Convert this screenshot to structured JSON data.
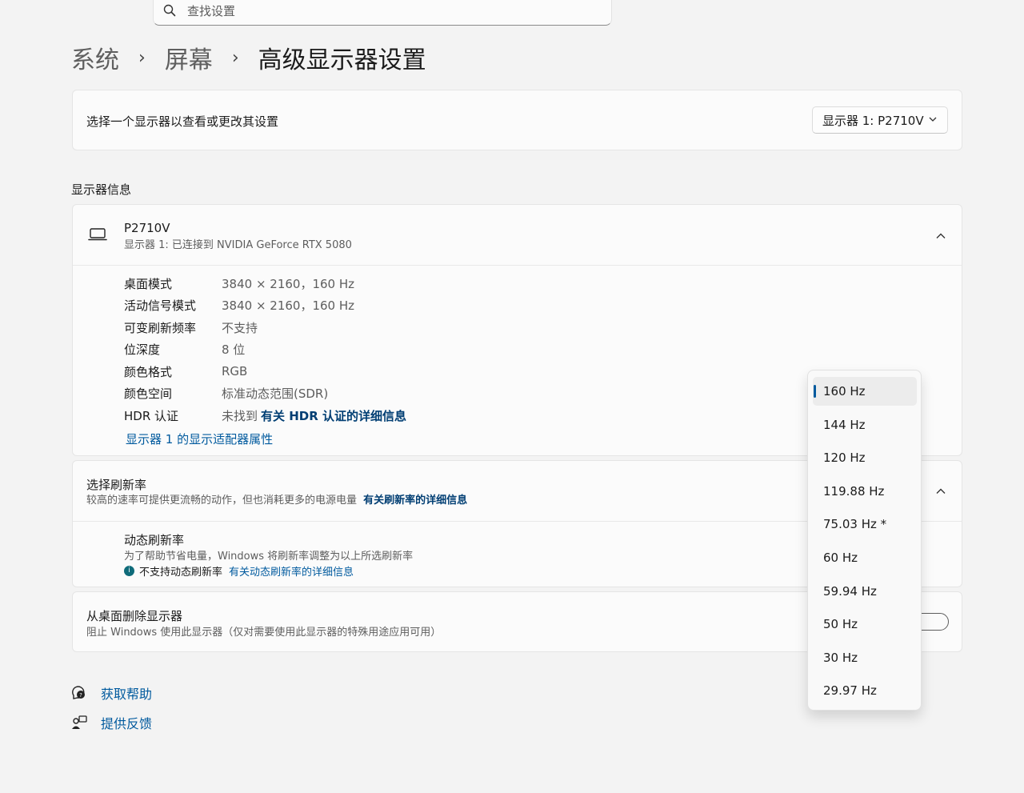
{
  "search": {
    "placeholder": "查找设置"
  },
  "breadcrumb": {
    "items": [
      "系统",
      "屏幕"
    ],
    "current": "高级显示器设置"
  },
  "select_monitor": {
    "label": "选择一个显示器以查看或更改其设置",
    "value": "显示器 1: P2710V"
  },
  "display_info": {
    "section_title": "显示器信息",
    "monitor_name": "P2710V",
    "monitor_desc": "显示器 1: 已连接到 NVIDIA GeForce RTX 5080",
    "rows": [
      {
        "label": "桌面模式",
        "value": "3840 × 2160，160 Hz"
      },
      {
        "label": "活动信号模式",
        "value": "3840 × 2160，160 Hz"
      },
      {
        "label": "可变刷新频率",
        "value": "不支持"
      },
      {
        "label": "位深度",
        "value": "8 位"
      },
      {
        "label": "颜色格式",
        "value": "RGB"
      },
      {
        "label": "颜色空间",
        "value": "标准动态范围(SDR)"
      },
      {
        "label": "HDR 认证",
        "value": "未找到",
        "link": "有关 HDR 认证的详细信息"
      }
    ],
    "adapter_link": "显示器 1 的显示适配器属性"
  },
  "refresh_rate": {
    "title": "选择刷新率",
    "desc": "较高的速率可提供更流畅的动作，但也消耗更多的电源电量",
    "link": "有关刷新率的详细信息",
    "options": [
      "160 Hz",
      "144 Hz",
      "120 Hz",
      "119.88 Hz",
      "75.03 Hz *",
      "60 Hz",
      "59.94 Hz",
      "50 Hz",
      "30 Hz",
      "29.97 Hz"
    ],
    "selected": "160 Hz"
  },
  "dynamic_refresh": {
    "title": "动态刷新率",
    "desc": "为了帮助节省电量，Windows 将刷新率调整为以上所选刷新率",
    "note": "不支持动态刷新率",
    "note_link": "有关动态刷新率的详细信息"
  },
  "remove_display": {
    "title": "从桌面删除显示器",
    "desc": "阻止 Windows 使用此显示器（仅对需要使用此显示器的特殊用途应用可用）",
    "toggle_on": false
  },
  "footer": {
    "help": "获取帮助",
    "feedback": "提供反馈"
  },
  "colors": {
    "accent": "#005a9e",
    "background": "#f3f3f3"
  }
}
